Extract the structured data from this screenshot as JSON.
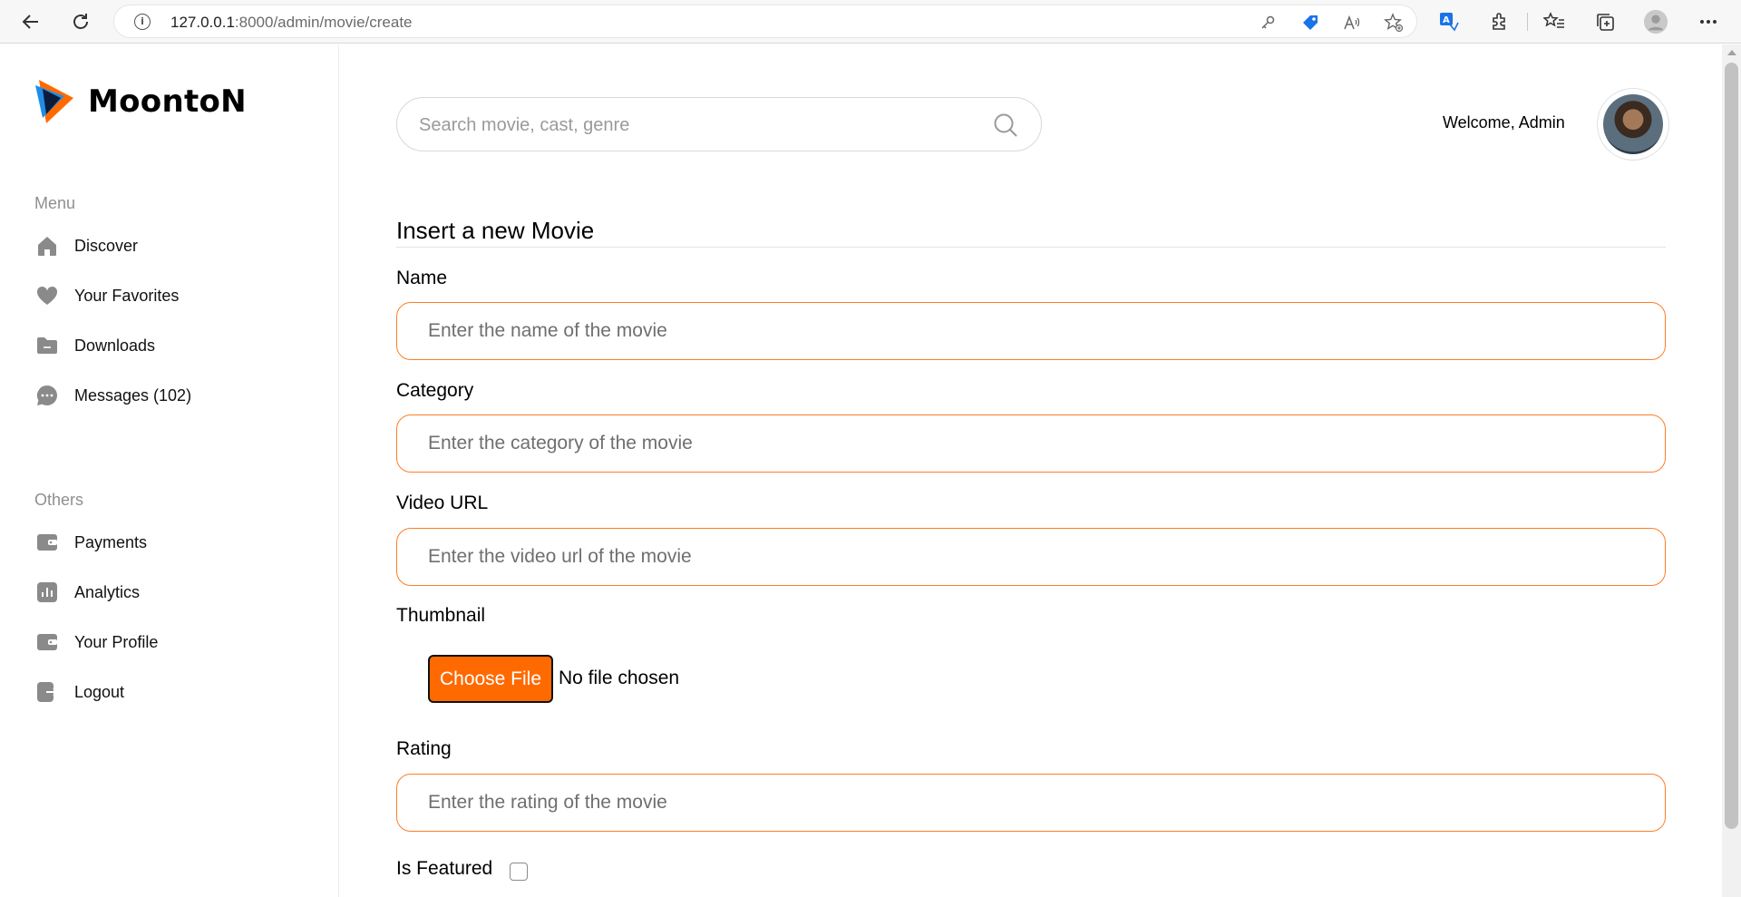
{
  "browser": {
    "url_host": "127.0.0.1",
    "url_rest": ":8000/admin/movie/create"
  },
  "sidebar": {
    "brand": "MoontoN",
    "menu_heading": "Menu",
    "menu_items": [
      {
        "label": "Discover",
        "icon": "home-icon"
      },
      {
        "label": "Your Favorites",
        "icon": "heart-icon"
      },
      {
        "label": "Downloads",
        "icon": "folder-icon"
      },
      {
        "label": "Messages (102)",
        "icon": "chat-icon"
      }
    ],
    "others_heading": "Others",
    "other_items": [
      {
        "label": "Payments",
        "icon": "wallet-icon"
      },
      {
        "label": "Analytics",
        "icon": "chart-icon"
      },
      {
        "label": "Your Profile",
        "icon": "wallet-icon"
      },
      {
        "label": "Logout",
        "icon": "logout-icon"
      }
    ]
  },
  "header": {
    "search_placeholder": "Search movie, cast, genre",
    "welcome": "Welcome, Admin"
  },
  "form": {
    "title": "Insert a new Movie",
    "name_label": "Name",
    "name_placeholder": "Enter the name of the movie",
    "category_label": "Category",
    "category_placeholder": "Enter the category of the movie",
    "video_label": "Video URL",
    "video_placeholder": "Enter the video url of the movie",
    "thumbnail_label": "Thumbnail",
    "choose_file": "Choose File",
    "no_file": "No file chosen",
    "rating_label": "Rating",
    "rating_placeholder": "Enter the rating of the movie",
    "featured_label": "Is Featured"
  },
  "colors": {
    "accent": "#ff6a00",
    "input_border": "#ff7d26",
    "brand_blue": "#1f8de8"
  }
}
